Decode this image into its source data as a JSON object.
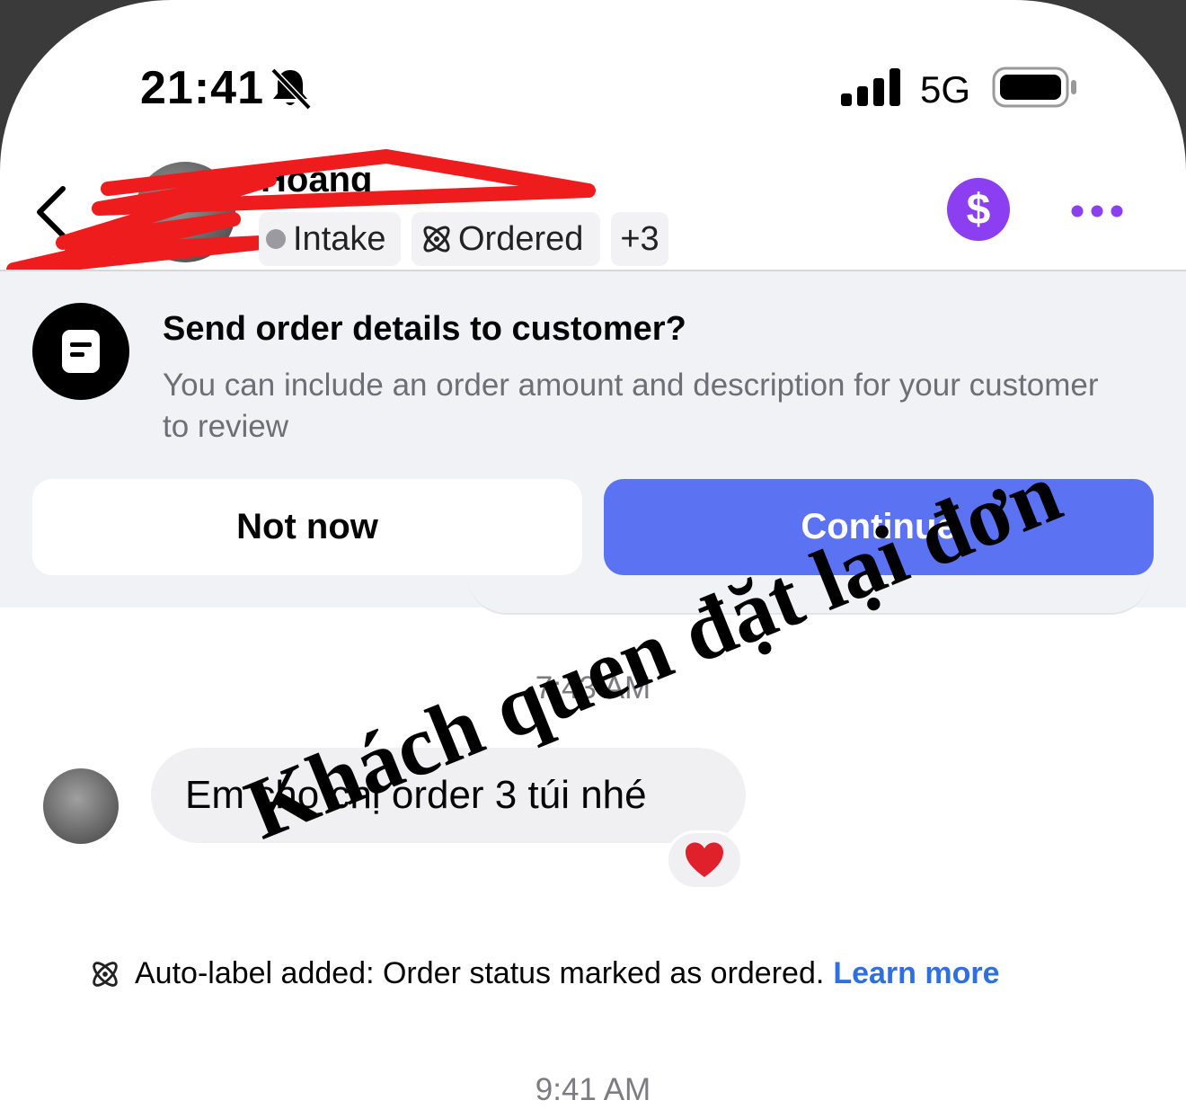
{
  "status_bar": {
    "time": "21:41",
    "network": "5G",
    "icons": [
      "bell-slash-icon",
      "signal-icon",
      "battery-icon"
    ]
  },
  "header": {
    "contact_name": "Hoang",
    "labels": [
      {
        "text": "Intake",
        "icon": "gray-dot"
      },
      {
        "text": "Ordered",
        "icon": "atom-icon"
      },
      {
        "text": "+3",
        "icon": ""
      }
    ],
    "action_icons": [
      "dollar-icon",
      "more-icon"
    ],
    "accent_color": "#8b3ff0"
  },
  "banner": {
    "title": "Send order details to customer?",
    "description": "You can include an order amount and description for your customer to review",
    "not_now_label": "Not now",
    "continue_label": "Continue",
    "continue_color": "#5b72f2"
  },
  "chat": {
    "timestamp_1": "7:43 AM",
    "message_text": "Em cho chị order 3 túi nhé",
    "reaction": "❤️",
    "system_message": "Auto-label added: Order status marked as ordered.",
    "learn_more": "Learn more",
    "timestamp_2": "9:41 AM"
  },
  "overlay": {
    "caption": "Khách quen đặt lại đơn"
  }
}
